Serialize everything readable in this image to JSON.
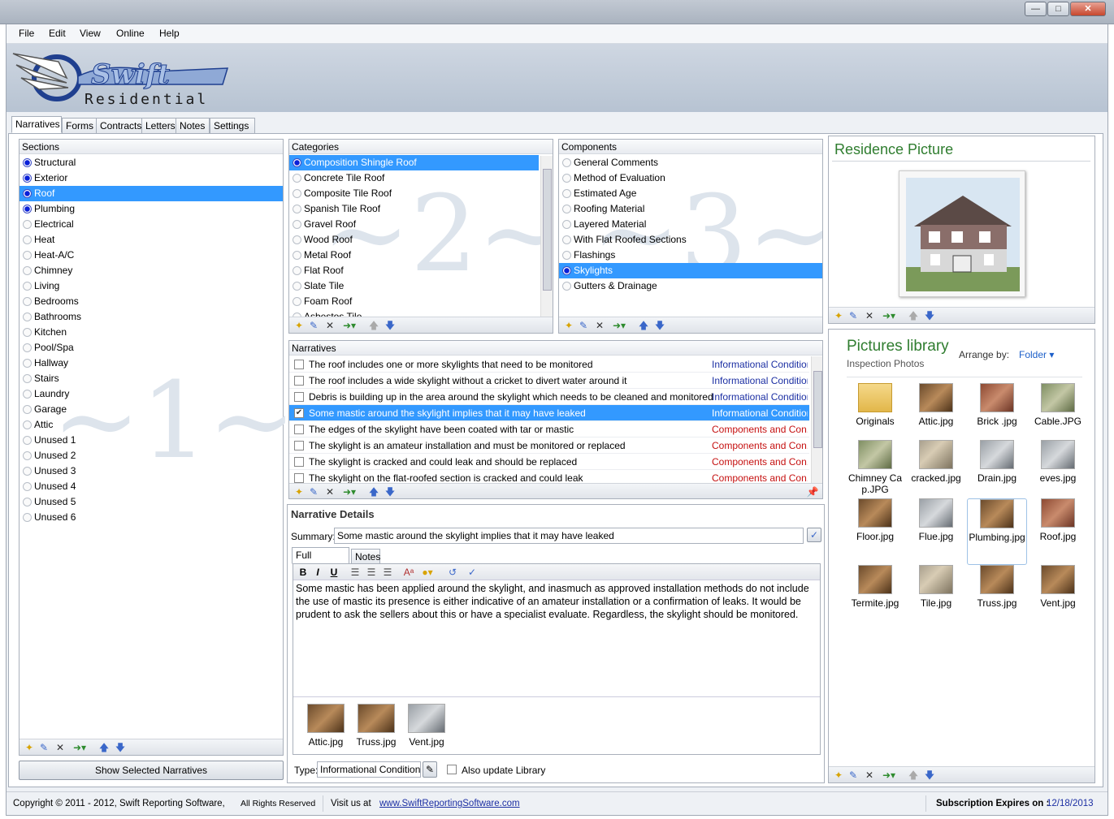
{
  "window": {
    "controls": [
      "minimize",
      "maximize",
      "close"
    ]
  },
  "menu": [
    "File",
    "Edit",
    "View",
    "Online",
    "Help"
  ],
  "logo": {
    "line1": "Swift",
    "line2": "Residential"
  },
  "tabs": [
    "Narratives",
    "Forms",
    "Contracts",
    "Letters",
    "Notes",
    "Settings"
  ],
  "sections": {
    "header": "Sections",
    "items": [
      "Structural",
      "Exterior",
      "Roof",
      "Plumbing",
      "Electrical",
      "Heat",
      "Heat-A/C",
      "Chimney",
      "Living",
      "Bedrooms",
      "Bathrooms",
      "Kitchen",
      "Pool/Spa",
      "Hallway",
      "Stairs",
      "Laundry",
      "Garage",
      "Attic",
      "Unused 1",
      "Unused 2",
      "Unused 3",
      "Unused 4",
      "Unused 5",
      "Unused 6"
    ],
    "checked": [
      0,
      1,
      2,
      3
    ],
    "selected": 2,
    "watermark": "~1~",
    "show_button": "Show Selected Narratives"
  },
  "categories": {
    "header": "Categories",
    "items": [
      "Composition Shingle Roof",
      "Concrete Tile Roof",
      "Composite Tile Roof",
      "Spanish Tile Roof",
      "Gravel Roof",
      "Wood Roof",
      "Metal Roof",
      "Flat Roof",
      "Slate Tile",
      "Foam Roof",
      "Asbestos Tile"
    ],
    "selected": 0,
    "watermark": "~2~"
  },
  "components": {
    "header": "Components",
    "items": [
      "General Comments",
      "Method of Evaluation",
      "Estimated Age",
      "Roofing Material",
      "Layered Material",
      "With Flat Roofed Sections",
      "Flashings",
      "Skylights",
      "Gutters & Drainage"
    ],
    "selected": 7,
    "watermark": "~3~"
  },
  "narratives": {
    "header": "Narratives",
    "rows": [
      {
        "text": "The roof includes one or more skylights that need to be monitored",
        "type": "Informational Conditions",
        "kind": "info",
        "checked": false
      },
      {
        "text": "The roof includes a wide skylight without a cricket to divert water around it",
        "type": "Informational Conditions",
        "kind": "info",
        "checked": false
      },
      {
        "text": "Debris is building up in the area around the skylight which needs to be cleaned and monitored",
        "type": "Informational Conditions",
        "kind": "info",
        "checked": false
      },
      {
        "text": "Some mastic around the skylight implies that it may have leaked",
        "type": "Informational Conditions",
        "kind": "info",
        "checked": true
      },
      {
        "text": "The edges of the skylight have been coated with tar or mastic",
        "type": "Components and Con...",
        "kind": "comp",
        "checked": false
      },
      {
        "text": "The skylight is an amateur installation and must be monitored or replaced",
        "type": "Components and Con...",
        "kind": "comp",
        "checked": false
      },
      {
        "text": "The skylight is cracked and could leak and should be replaced",
        "type": "Components and Con...",
        "kind": "comp",
        "checked": false
      },
      {
        "text": "The skylight on the flat-roofed section is cracked and could leak",
        "type": "Components and Con...",
        "kind": "comp",
        "checked": false
      }
    ],
    "selected": 3
  },
  "details": {
    "title": "Narrative Details",
    "summary_label": "Summary:",
    "summary": "Some mastic around the skylight implies that it may have leaked",
    "tabs": [
      "Full Narrative",
      "Notes"
    ],
    "fmt": {
      "bold": "B",
      "italic": "I",
      "underline": "U"
    },
    "full_text": "Some mastic has been applied around the skylight, and inasmuch as approved installation methods do not include the use of mastic its presence is either indicative of an amateur installation or a confirmation of leaks. It would be prudent to ask the sellers about this or have a specialist evaluate. Regardless, the skylight should be monitored.",
    "photos": [
      "Attic.jpg",
      "Truss.jpg",
      "Vent.jpg"
    ],
    "type_label": "Type:",
    "type_value": "Informational Conditions",
    "update_label": "Also update Library"
  },
  "residence": {
    "title": "Residence Picture"
  },
  "library": {
    "title": "Pictures library",
    "subtitle": "Inspection Photos",
    "arrange_label": "Arrange by:",
    "arrange_value": "Folder",
    "items": [
      {
        "name": "Originals",
        "style": "t-folder"
      },
      {
        "name": "Attic.jpg",
        "style": "t-wood"
      },
      {
        "name": "Brick .jpg",
        "style": "t-brick"
      },
      {
        "name": "Cable.JPG",
        "style": "t-green"
      },
      {
        "name": "Chimney Cap.JPG",
        "style": "t-green"
      },
      {
        "name": "cracked.jpg",
        "style": "t-stone"
      },
      {
        "name": "Drain.jpg",
        "style": "t-gray"
      },
      {
        "name": "eves.jpg",
        "style": "t-gray"
      },
      {
        "name": "Floor.jpg",
        "style": "t-wood"
      },
      {
        "name": "Flue.jpg",
        "style": "t-gray"
      },
      {
        "name": "Plumbing.jpg",
        "style": "t-wood"
      },
      {
        "name": "Roof.jpg",
        "style": "t-brick"
      },
      {
        "name": "Termite.jpg",
        "style": "t-wood"
      },
      {
        "name": "Tile.jpg",
        "style": "t-stone"
      },
      {
        "name": "Truss.jpg",
        "style": "t-wood"
      },
      {
        "name": "Vent.jpg",
        "style": "t-wood"
      }
    ],
    "selected": 10
  },
  "status": {
    "copyright": "Copyright © 2011 - 2012, Swift Reporting Software,",
    "rights": "All Rights Reserved",
    "visit": "Visit us at",
    "url": "www.SwiftReportingSoftware.com",
    "expires_label": "Subscription Expires on :",
    "expires": "12/18/2013"
  },
  "colors": {
    "selection": "#3399ff",
    "info": "#1c2fa3",
    "comp": "#c51010",
    "accent": "#2f7d2f"
  }
}
